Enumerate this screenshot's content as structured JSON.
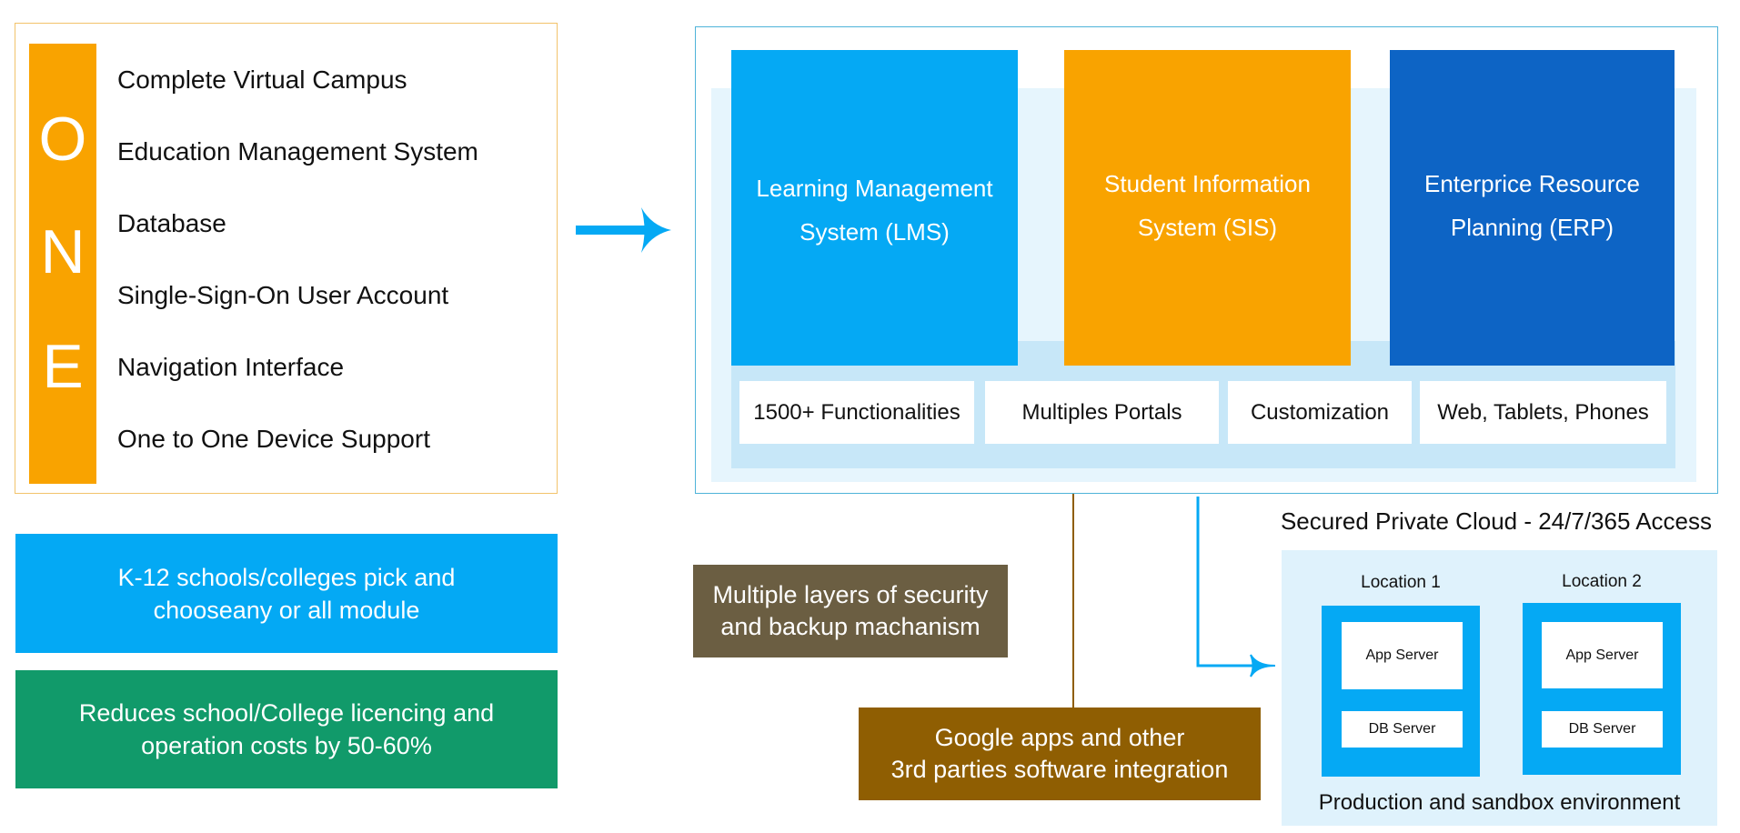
{
  "one_panel": {
    "letters": [
      "O",
      "N",
      "E"
    ],
    "items": [
      "Complete Virtual Campus",
      "Education Management System",
      "Database",
      "Single-Sign-On User Account",
      "Navigation Interface",
      "One to One Device Support"
    ]
  },
  "benefits": {
    "modules_note": [
      "K-12 schools/colleges pick and",
      "chooseany or all module"
    ],
    "cost_note": [
      "Reduces school/College licencing and",
      "operation costs by 50-60%"
    ]
  },
  "modules": [
    {
      "line1": "Learning Management",
      "line2": "System (LMS)"
    },
    {
      "line1": "Student Information",
      "line2": "System (SIS)"
    },
    {
      "line1": "Enterprice Resource",
      "line2": "Planning (ERP)"
    }
  ],
  "features": [
    "1500+ Functionalities",
    "Multiples Portals",
    "Customization",
    "Web, Tablets, Phones"
  ],
  "notes": {
    "security": [
      "Multiple layers of security",
      "and backup machanism"
    ],
    "integration": [
      "Google apps and other",
      "3rd parties software integration"
    ]
  },
  "cloud": {
    "title": "Secured Private Cloud - 24/7/365 Access",
    "locations": [
      {
        "label": "Location 1",
        "app": "App Server",
        "db": "DB Server"
      },
      {
        "label": "Location 2",
        "app": "App Server",
        "db": "DB Server"
      }
    ],
    "footer": "Production and sandbox environment"
  },
  "colors": {
    "orange": "#f9a300",
    "light_blue": "#05a9f4",
    "dark_blue": "#0d64c5",
    "green": "#119a6a",
    "olive_brown": "#6b5e42",
    "brown": "#8f5e02"
  },
  "icons": {
    "flow_arrow": "arrow-right-icon",
    "cloud_arrow": "elbow-arrow-icon"
  }
}
